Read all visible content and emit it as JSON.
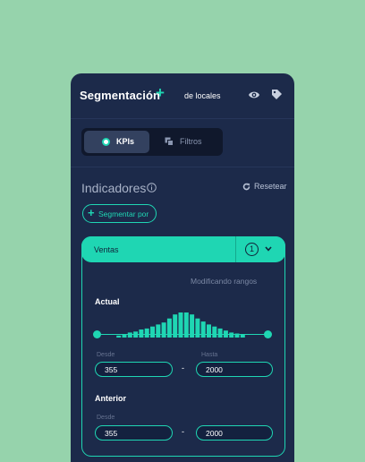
{
  "header": {
    "title": "Segmentación",
    "plus": "+",
    "subtitle": "de locales",
    "icons": [
      "eye-icon",
      "tag-icon"
    ]
  },
  "segmented": {
    "kpis_label": "KPIs",
    "filtros_label": "Filtros",
    "active": "KPIs"
  },
  "indicadores": {
    "title": "Indicadores",
    "reset_label": "Resetear",
    "segmentar_label": "Segmentar por",
    "segmentar_icon": "+"
  },
  "card": {
    "title": "Ventas",
    "badge": "1",
    "status": "Modificando rangos",
    "actual": {
      "label": "Actual",
      "desde_label": "Desde",
      "hasta_label": "Hasta",
      "desde": "355",
      "hasta": "2000",
      "separator": "-",
      "histogram": [
        2,
        3,
        5,
        6,
        8,
        9,
        11,
        13,
        15,
        19,
        23,
        25,
        25,
        23,
        19,
        16,
        13,
        11,
        9,
        7,
        5,
        4,
        3
      ]
    },
    "anterior": {
      "label": "Anterior",
      "desde_label": "Desde",
      "desde": "355",
      "hasta": "2000",
      "separator": "-"
    }
  },
  "colors": {
    "background": "#96d3ac",
    "panel": "#1c2a4a",
    "accent": "#1fd6b3"
  }
}
